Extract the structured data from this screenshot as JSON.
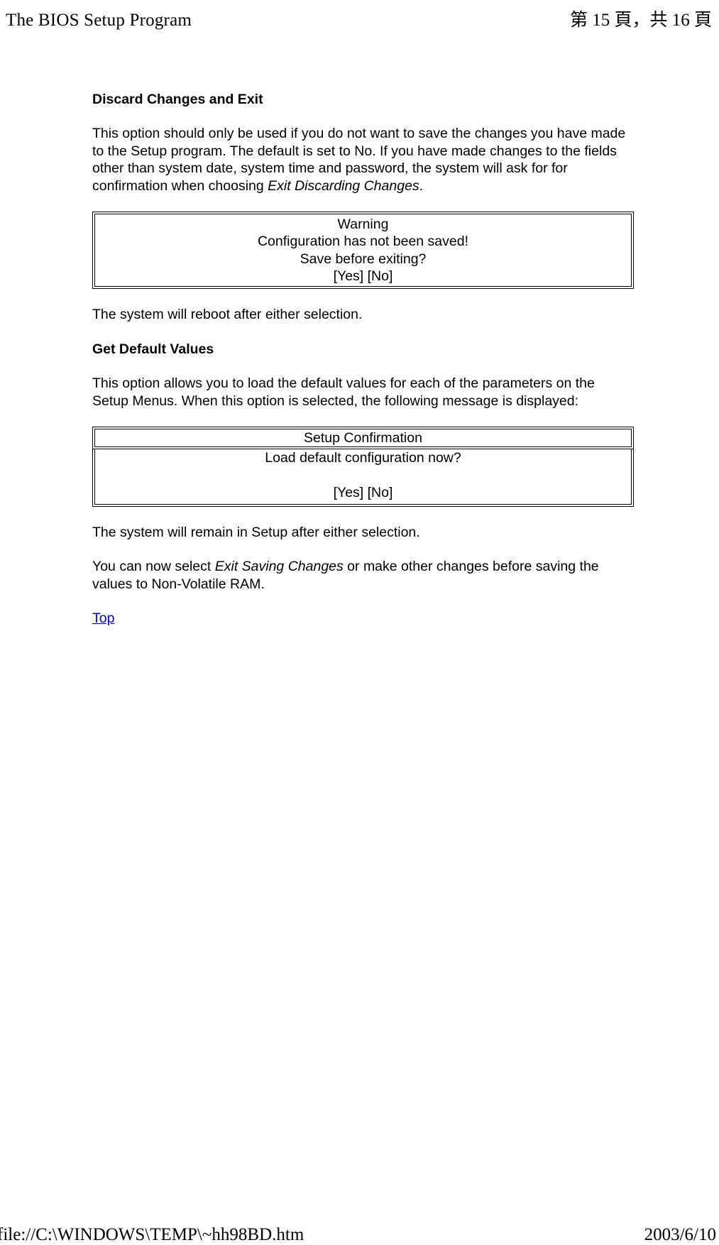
{
  "header": {
    "left": "The BIOS Setup Program",
    "right": "第 15 頁，共 16 頁"
  },
  "section1": {
    "heading": "Discard Changes and Exit",
    "para_before_italic": "This option should only be used if you do not want to save the changes you have made to the Setup program. The default is set to No. If you have made changes to the fields other than system date, system time and password, the system will ask for for confirmation when choosing ",
    "para_italic": "Exit Discarding Changes",
    "para_after_italic": "."
  },
  "box1": {
    "line1": "Warning",
    "line2": "Configuration has not been saved!",
    "line3": "Save before exiting?",
    "line4": "[Yes] [No]"
  },
  "after_box1": "The system will reboot after either selection.",
  "section2": {
    "heading": "Get Default Values",
    "para": "This option allows you to load the default values for each of the parameters on the Setup Menus. When this option is selected, the following message is displayed:"
  },
  "box2": {
    "top": "Setup Confirmation",
    "bottom_line1": "Load default configuration now?",
    "bottom_line2": "[Yes] [No]"
  },
  "after_box2": "The system will remain in Setup after either selection.",
  "final_para_before": "You can now select ",
  "final_para_italic": "Exit Saving Changes",
  "final_para_after": " or make other changes before saving the values to Non-Volatile RAM.",
  "top_link": "Top",
  "footer": {
    "left": "file://C:\\WINDOWS\\TEMP\\~hh98BD.htm",
    "right": "2003/6/10"
  }
}
